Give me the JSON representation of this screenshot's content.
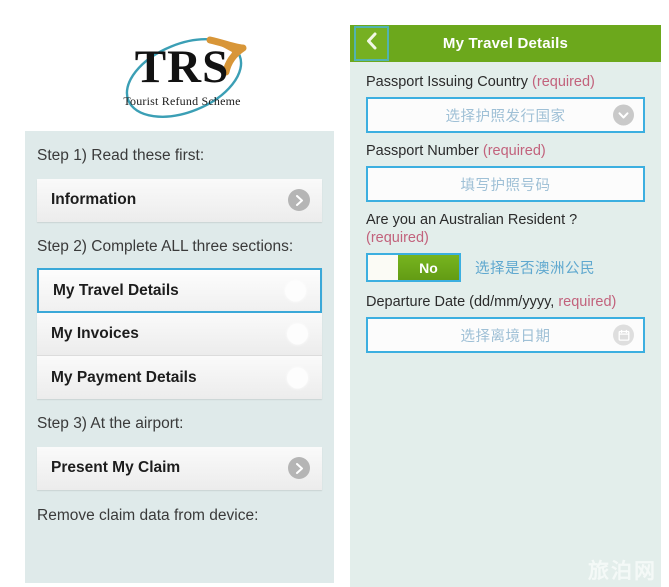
{
  "left_panel": {
    "logo": {
      "mark": "TRS",
      "tagline": "Tourist Refund Scheme",
      "swoosh_color": "#3b9fb5",
      "boomerang_color": "#d89638"
    },
    "steps": [
      {
        "label": "Step 1) Read these first:"
      },
      {
        "label": "Step 2) Complete ALL three sections:"
      },
      {
        "label": "Step 3) At the airport:"
      },
      {
        "label": "Remove claim data from device:"
      }
    ],
    "group1": [
      {
        "label": "Information",
        "icon": "chevron-right-icon",
        "selected": false
      }
    ],
    "group2": [
      {
        "label": "My Travel Details",
        "selected": true
      },
      {
        "label": "My Invoices",
        "selected": false
      },
      {
        "label": "My Payment Details",
        "selected": false
      }
    ],
    "group3": [
      {
        "label": "Present My Claim",
        "icon": "chevron-right-icon",
        "selected": false
      }
    ],
    "colors": {
      "card_bg": "#dfeaea",
      "selected_border": "#3aa8d8"
    }
  },
  "right_panel": {
    "header": {
      "title": "My Travel Details",
      "back_icon": "chevron-left-icon",
      "bg": "#6ca81c",
      "back_border": "#52b3b0"
    },
    "fields": [
      {
        "label_main": "Passport Issuing Country ",
        "label_required": "(required)",
        "placeholder": "选择护照发行国家",
        "icon": "chevron-down-icon"
      },
      {
        "label_main": "Passport Number ",
        "label_required": "(required)",
        "placeholder": "填写护照号码",
        "icon": ""
      }
    ],
    "resident_question": {
      "label_main": "Are you an Australian Resident ?",
      "label_required": "(required)",
      "toggle_value": "No",
      "hint": "选择是否澳洲公民"
    },
    "departure": {
      "label_main": "Departure Date (dd/mm/yyyy, ",
      "label_required": "required)",
      "placeholder": "选择离境日期",
      "icon": "calendar-icon"
    },
    "colors": {
      "body_bg": "#e3eeeb",
      "field_border": "#3cafe0",
      "required_text": "#c2627c",
      "placeholder_text": "#9fc0d6"
    }
  },
  "watermark": {
    "text": "旅泊网"
  }
}
